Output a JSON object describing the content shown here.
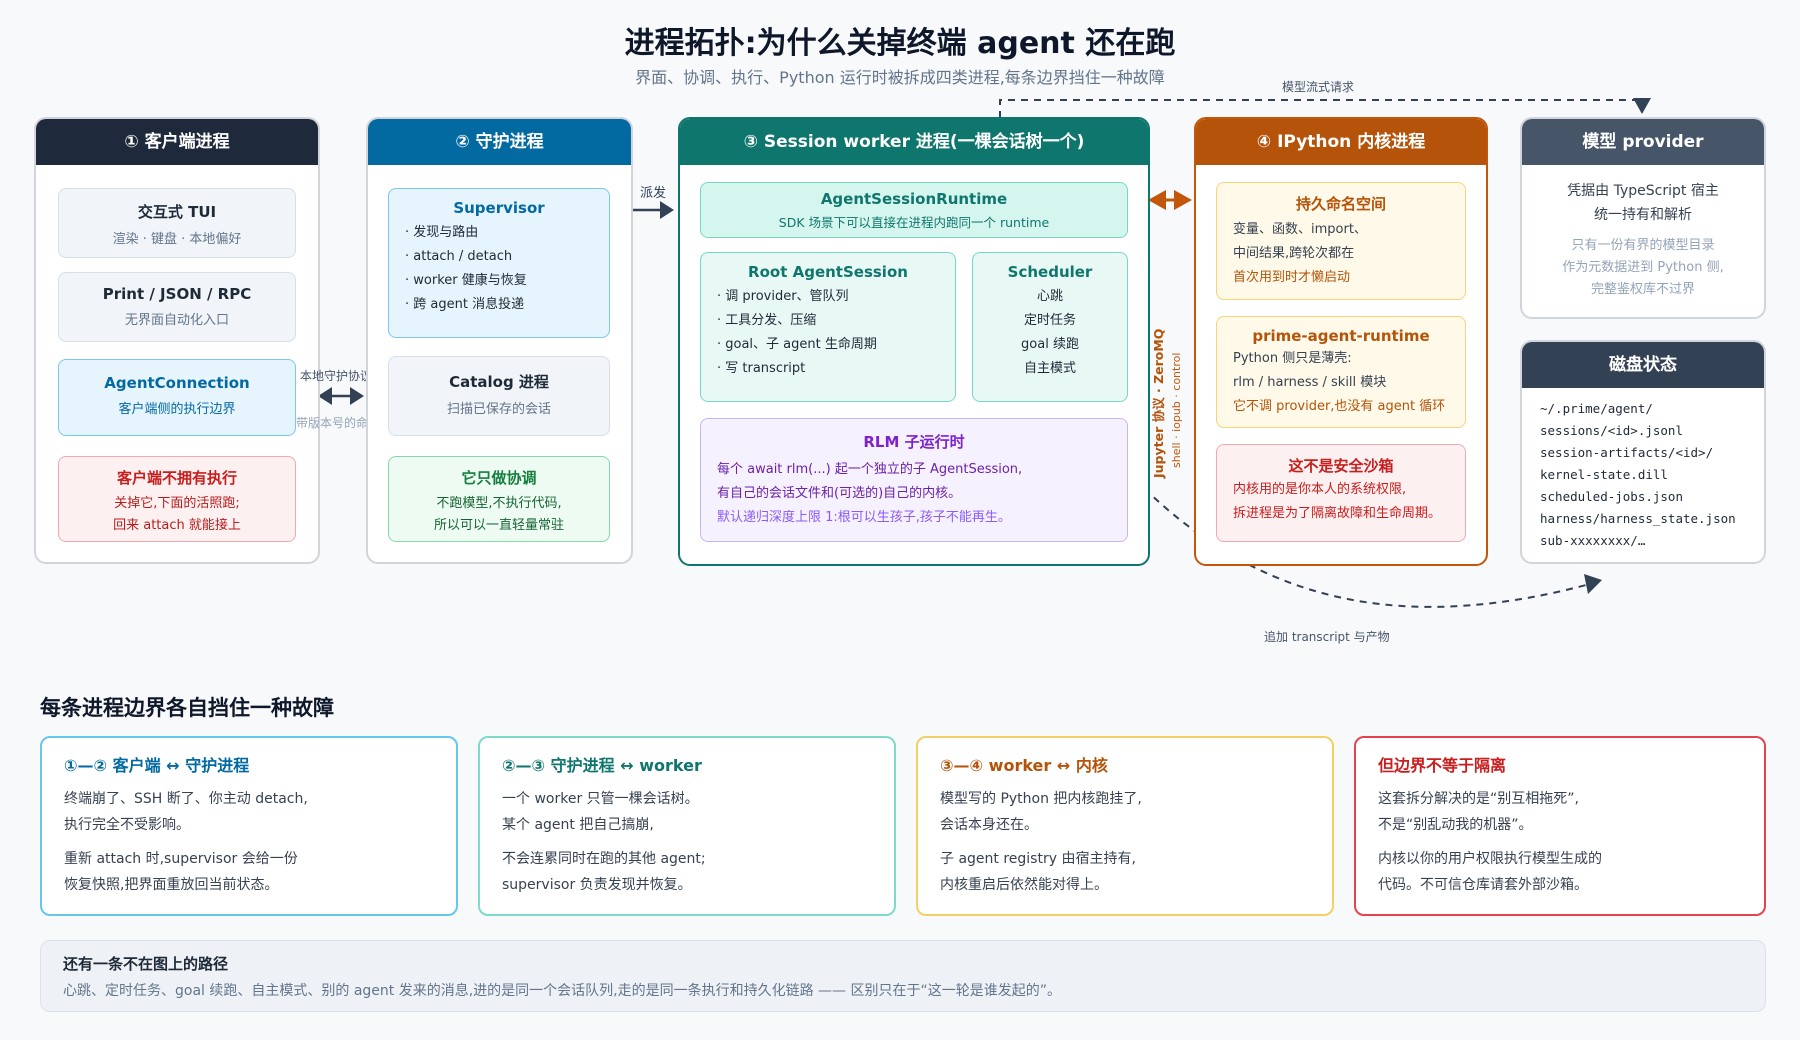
{
  "title": "进程拓扑:为什么关掉终端 agent 还在跑",
  "subtitle": "界面、协调、执行、Python 运行时被拆成四类进程,每条边界挡住一种故障",
  "colors": {
    "client_head": "#1e293b",
    "supervisor_head": "#0369a1",
    "worker_head": "#0f766e",
    "kernel_head": "#b45309",
    "provider_head": "#475569"
  },
  "client": {
    "header": "① 客户端进程",
    "tui": {
      "title": "交互式 TUI",
      "sub": "渲染 · 键盘 · 本地偏好"
    },
    "print": {
      "title": "Print / JSON / RPC",
      "sub": "无界面自动化入口"
    },
    "conn": {
      "title": "AgentConnection",
      "sub": "客户端侧的执行边界"
    },
    "noexec": {
      "title": "客户端不拥有执行",
      "l1": "关掉它,下面的活照跑;",
      "l2": "回来 attach 就能接上"
    }
  },
  "link1": {
    "top": "本地守护协议",
    "bottom": "带版本号的命令"
  },
  "supervisor": {
    "header": "② 守护进程",
    "box_title": "Supervisor",
    "items": [
      "· 发现与路由",
      "· attach / detach",
      "· worker 健康与恢复",
      "· 跨 agent 消息投递"
    ],
    "catalog": {
      "title": "Catalog 进程",
      "sub": "扫描已保存的会话"
    },
    "coord": {
      "title": "它只做协调",
      "l1": "不跑模型,不执行代码,",
      "l2": "所以可以一直轻量常驻"
    }
  },
  "dispatch_label": "派发",
  "worker": {
    "header": "③ Session worker 进程(一棵会话树一个)",
    "runtime": {
      "title": "AgentSessionRuntime",
      "sub": "SDK 场景下可以直接在进程内跑同一个 runtime"
    },
    "root": {
      "title": "Root AgentSession",
      "items": [
        "· 调 provider、管队列",
        "· 工具分发、压缩",
        "· goal、子 agent 生命周期",
        "· 写 transcript"
      ]
    },
    "scheduler": {
      "title": "Scheduler",
      "items": [
        "心跳",
        "定时任务",
        "goal 续跑",
        "自主模式"
      ]
    },
    "rlm": {
      "title": "RLM 子运行时",
      "l1": "每个 await rlm(...) 起一个独立的子 AgentSession,",
      "l2": "有自己的会话文件和(可选的)自己的内核。",
      "l3": "默认递归深度上限 1:根可以生孩子,孩子不能再生。"
    }
  },
  "jupyter": {
    "main": "Jupyter 协议 · ZeroMQ",
    "sub": "shell · iopub · control"
  },
  "kernel": {
    "header": "④ IPython 内核进程",
    "ns": {
      "title": "持久命名空间",
      "l1": "变量、函数、import、",
      "l2": "中间结果,跨轮次都在",
      "l3": "首次用到时才懒启动"
    },
    "prime": {
      "title": "prime-agent-runtime",
      "l1": "Python 侧只是薄壳:",
      "l2": "rlm / harness / skill 模块",
      "l3": "它不调 provider,也没有 agent 循环"
    },
    "sandbox": {
      "title": "这不是安全沙箱",
      "l1": "内核用的是你本人的系统权限,",
      "l2": "拆进程是为了隔离故障和生命周期。"
    }
  },
  "stream_label": "模型流式请求",
  "append_label": "追加 transcript 与产物",
  "provider": {
    "header": "模型 provider",
    "l1": "凭据由 TypeScript 宿主",
    "l2": "统一持有和解析",
    "n1": "只有一份有界的模型目录",
    "n2": "作为元数据进到 Python 侧,",
    "n3": "完整鉴权库不过界"
  },
  "disk": {
    "header": "磁盘状态",
    "paths": [
      "~/.prime/agent/",
      "sessions/<id>.jsonl",
      "session-artifacts/<id>/",
      "kernel-state.dill",
      "scheduled-jobs.json",
      "harness/harness_state.json",
      "sub-xxxxxxxx/…"
    ]
  },
  "section_title": "每条进程边界各自挡住一种故障",
  "failures": [
    {
      "title": "①—② 客户端 ↔ 守护进程",
      "color": "#0369a1",
      "border": "#67c6ee",
      "p1a": "终端崩了、SSH 断了、你主动 detach,",
      "p1b": "执行完全不受影响。",
      "p2a": "重新 attach 时,supervisor 会给一份",
      "p2b": "恢复快照,把界面重放回当前状态。"
    },
    {
      "title": "②—③ 守护进程 ↔ worker",
      "color": "#0f766e",
      "border": "#7dd9cb",
      "p1a": "一个 worker 只管一棵会话树。",
      "p1b": "某个 agent 把自己搞崩,",
      "p2a": "不会连累同时在跑的其他 agent;",
      "p2b": "supervisor 负责发现并恢复。"
    },
    {
      "title": "③—④ worker ↔ 内核",
      "color": "#b45309",
      "border": "#f4cf66",
      "p1a": "模型写的 Python 把内核跑挂了,",
      "p1b": "会话本身还在。",
      "p2a": "子 agent registry 由宿主持有,",
      "p2b": "内核重启后依然能对得上。"
    },
    {
      "title": "但边界不等于隔离",
      "color": "#c81e1e",
      "border": "#e4424c",
      "p1a": "这套拆分解决的是“别互相拖死”,",
      "p1b": "不是“别乱动我的机器”。",
      "p2a": "内核以你的用户权限执行模型生成的",
      "p2b": "代码。不可信仓库请套外部沙箱。"
    }
  ],
  "note": {
    "title": "还有一条不在图上的路径",
    "body": "心跳、定时任务、goal 续跑、自主模式、别的 agent 发来的消息,进的是同一个会话队列,走的是同一条执行和持久化链路 —— 区别只在于“这一轮是谁发起的”。"
  }
}
